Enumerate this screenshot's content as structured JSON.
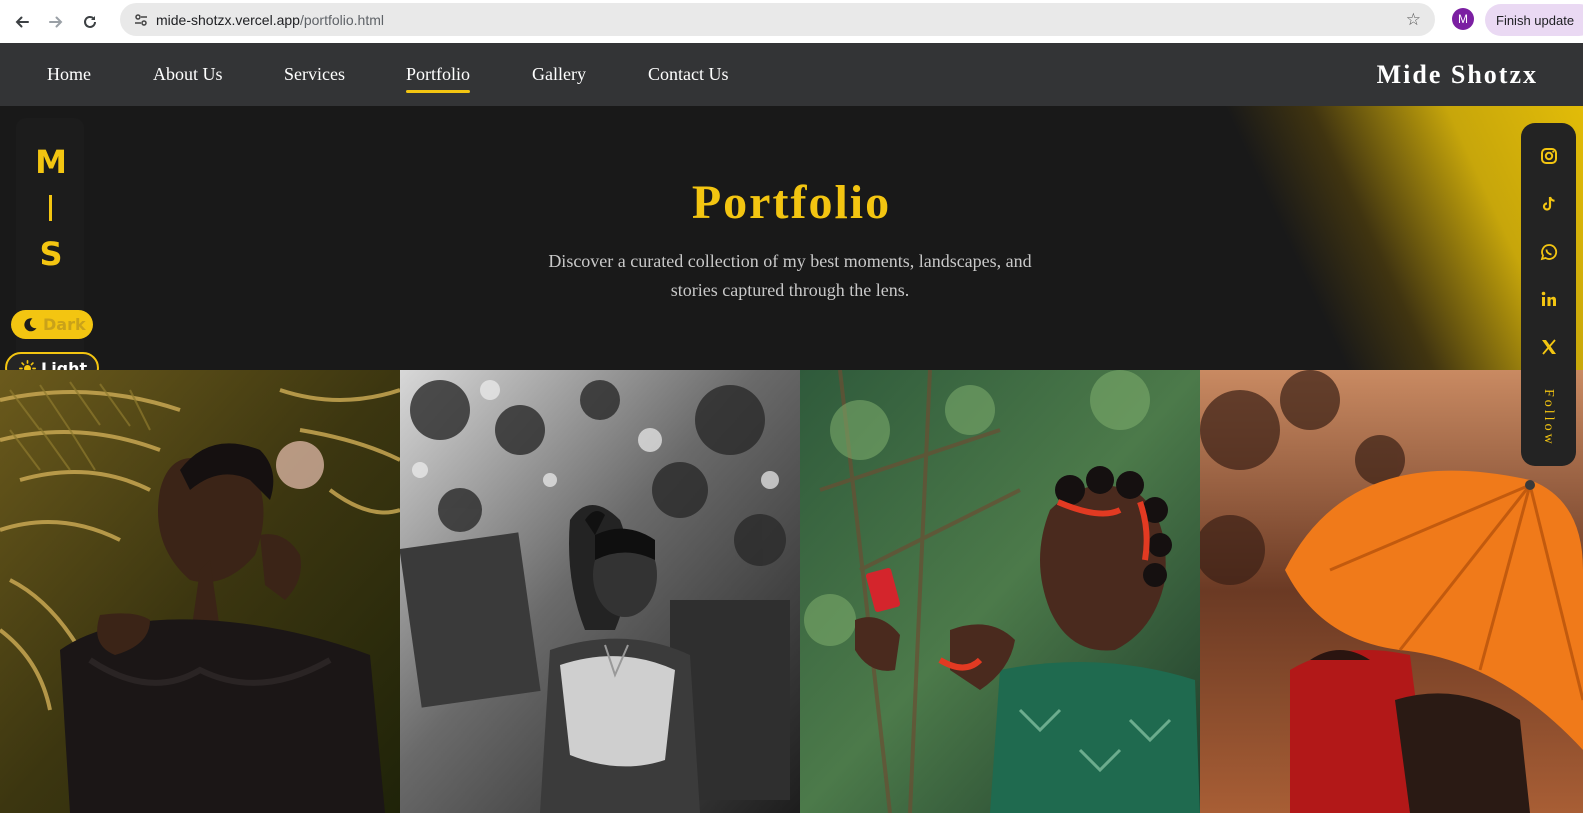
{
  "browser": {
    "url_host": "mide-shotzx.vercel.app",
    "url_path": "/portfolio.html",
    "profile_initial": "M",
    "update_label": "Finish update",
    "icons": [
      "back-arrow-icon",
      "forward-arrow-icon",
      "reload-icon",
      "site-settings-icon",
      "bookmark-star-icon",
      "kebab-menu-icon"
    ]
  },
  "nav": {
    "links": [
      "Home",
      "About Us",
      "Services",
      "Portfolio",
      "Gallery",
      "Contact Us"
    ],
    "active": "Portfolio",
    "brand": "Mide Shotzx"
  },
  "hero": {
    "title": "Portfolio",
    "subtitle": "Discover a curated collection of my best moments, landscapes, and stories captured through the lens."
  },
  "logo": {
    "top": "M",
    "bottom": "S"
  },
  "theme": {
    "dark_label": "Dark",
    "light_label": "Light"
  },
  "social": {
    "icons": [
      "instagram-icon",
      "tiktok-icon",
      "whatsapp-icon",
      "linkedin-icon",
      "x-icon"
    ],
    "follow_label": "Follow"
  },
  "colors": {
    "accent": "#f3c511",
    "background": "#191919",
    "nav_bg": "#333436",
    "umbrella": "#f07a1a"
  }
}
